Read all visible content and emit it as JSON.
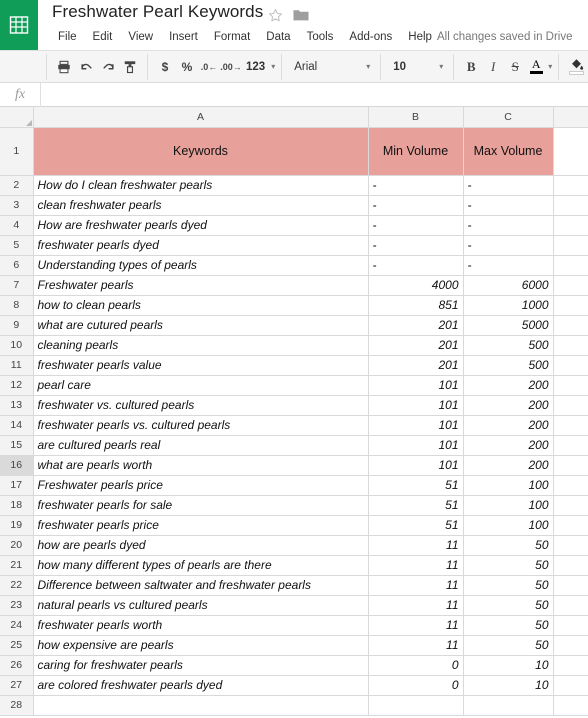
{
  "app": {
    "logo_icon": "sheets-grid-icon",
    "doc_title": "Freshwater Pearl Keywords",
    "star_icon": "star-outline-icon",
    "folder_icon": "folder-icon",
    "save_status": "All changes saved in Drive"
  },
  "menubar": {
    "items": [
      {
        "label": "File"
      },
      {
        "label": "Edit"
      },
      {
        "label": "View"
      },
      {
        "label": "Insert"
      },
      {
        "label": "Format"
      },
      {
        "label": "Data"
      },
      {
        "label": "Tools"
      },
      {
        "label": "Add-ons"
      },
      {
        "label": "Help"
      }
    ]
  },
  "toolbar": {
    "print_icon": "print-icon",
    "undo_icon": "undo-icon",
    "redo_icon": "redo-icon",
    "paint_format_icon": "paint-format-icon",
    "currency_label": "$",
    "percent_label": "%",
    "decrease_decimal_label": ".0",
    "increase_decimal_label": ".00",
    "more_formats_label": "123",
    "font_family": "Arial",
    "font_size": "10",
    "bold_label": "B",
    "italic_label": "I",
    "strikethrough_label": "S",
    "text_color_label": "A",
    "text_color_value": "#000000",
    "fill_color_icon": "fill-color-icon",
    "fill_color_value": "#ffffff",
    "caret_glyph": "▾"
  },
  "formula_bar": {
    "fx_label": "fx",
    "value": "",
    "placeholder": ""
  },
  "grid": {
    "column_headers": [
      "",
      "A",
      "B",
      "C",
      ""
    ],
    "selected_row": 16,
    "header_fill_color": "#e8a09a",
    "rows": [
      {
        "n": "1",
        "a": "Keywords",
        "b": "Min Volume",
        "c": "Max Volume"
      },
      {
        "n": "2",
        "a": "How do I clean freshwater pearls",
        "b": "-",
        "c": "-"
      },
      {
        "n": "3",
        "a": "clean freshwater pearls",
        "b": "-",
        "c": "-"
      },
      {
        "n": "4",
        "a": "How are freshwater pearls dyed",
        "b": "-",
        "c": "-"
      },
      {
        "n": "5",
        "a": "freshwater pearls dyed",
        "b": "-",
        "c": "-"
      },
      {
        "n": "6",
        "a": "Understanding types of pearls",
        "b": "-",
        "c": "-"
      },
      {
        "n": "7",
        "a": "Freshwater pearls",
        "b": "4000",
        "c": "6000"
      },
      {
        "n": "8",
        "a": "how to clean pearls",
        "b": "851",
        "c": "1000"
      },
      {
        "n": "9",
        "a": "what are cutured pearls",
        "b": "201",
        "c": "5000"
      },
      {
        "n": "10",
        "a": "cleaning pearls",
        "b": "201",
        "c": "500"
      },
      {
        "n": "11",
        "a": "freshwater pearls value",
        "b": "201",
        "c": "500"
      },
      {
        "n": "12",
        "a": "pearl care",
        "b": "101",
        "c": "200"
      },
      {
        "n": "13",
        "a": "freshwater vs. cultured pearls",
        "b": "101",
        "c": "200"
      },
      {
        "n": "14",
        "a": "freshwater pearls vs. cultured pearls",
        "b": "101",
        "c": "200"
      },
      {
        "n": "15",
        "a": "are cultured pearls real",
        "b": "101",
        "c": "200"
      },
      {
        "n": "16",
        "a": "what are pearls worth",
        "b": "101",
        "c": "200"
      },
      {
        "n": "17",
        "a": "Freshwater pearls price",
        "b": "51",
        "c": "100"
      },
      {
        "n": "18",
        "a": "freshwater pearls for sale",
        "b": "51",
        "c": "100"
      },
      {
        "n": "19",
        "a": "freshwater pearls price",
        "b": "51",
        "c": "100"
      },
      {
        "n": "20",
        "a": "how are pearls dyed",
        "b": "11",
        "c": "50"
      },
      {
        "n": "21",
        "a": "how many different types of pearls are there",
        "b": "11",
        "c": "50"
      },
      {
        "n": "22",
        "a": "Difference between saltwater and freshwater pearls",
        "b": "11",
        "c": "50"
      },
      {
        "n": "23",
        "a": "natural pearls vs cultured pearls",
        "b": "11",
        "c": "50"
      },
      {
        "n": "24",
        "a": "freshwater pearls worth",
        "b": "11",
        "c": "50"
      },
      {
        "n": "25",
        "a": "how expensive are pearls",
        "b": "11",
        "c": "50"
      },
      {
        "n": "26",
        "a": "caring for freshwater pearls",
        "b": "0",
        "c": "10"
      },
      {
        "n": "27",
        "a": "are colored freshwater pearls dyed",
        "b": "0",
        "c": "10"
      },
      {
        "n": "28",
        "a": "",
        "b": "",
        "c": ""
      }
    ]
  }
}
